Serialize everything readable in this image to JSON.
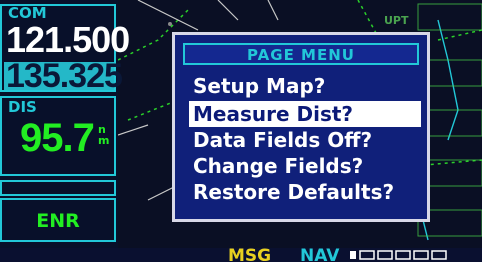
{
  "com": {
    "label": "COM",
    "active_freq": "121.500",
    "standby_freq": "135.325"
  },
  "dis": {
    "label": "DIS",
    "value": "95.7",
    "unit": "nm"
  },
  "mode": {
    "label": "ENR"
  },
  "map": {
    "label": "UPT"
  },
  "status_bar": {
    "msg_label": "MSG",
    "nav_label": "NAV"
  },
  "page_menu": {
    "title": "PAGE MENU",
    "items": [
      {
        "label": "Setup Map?",
        "selected": false
      },
      {
        "label": "Measure Dist?",
        "selected": true
      },
      {
        "label": "Data Fields Off?",
        "selected": false
      },
      {
        "label": "Change Fields?",
        "selected": false
      },
      {
        "label": "Restore Defaults?",
        "selected": false
      }
    ]
  },
  "colors": {
    "accent_cyan": "#22c8d8",
    "data_green": "#22ee22",
    "menu_blue": "#10207a",
    "msg_yellow": "#e8d020"
  }
}
